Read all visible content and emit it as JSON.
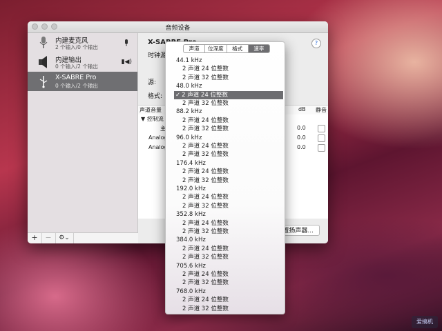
{
  "window": {
    "title": "音频设备"
  },
  "devices": [
    {
      "name": "内建麦克风",
      "sub": "2 个输入/0 个输出"
    },
    {
      "name": "内建输出",
      "sub": "0 个输入/2 个输出"
    },
    {
      "name": "X-SABRE Pro",
      "sub": "0 个输入/2 个输出"
    }
  ],
  "bottombar": {
    "add": "+",
    "remove": "−",
    "gear": "⚙︎⌄"
  },
  "main": {
    "device_title": "X-SABRE Pro",
    "clock_label": "时钟源",
    "source_label": "源:",
    "format_label": "格式:",
    "table_headers": {
      "channel_volume": "声道音量",
      "db": "dB",
      "mute": "静音"
    },
    "group_label": "▼ 控制流",
    "rows": [
      {
        "label": "主",
        "db": "0.0"
      },
      {
        "label": "Analog",
        "db": "0.0"
      },
      {
        "label": "Analog",
        "db": "0.0"
      }
    ],
    "config_speakers": "置扬声器..."
  },
  "popup": {
    "tabs": [
      "声道",
      "位深度",
      "格式",
      "速率"
    ],
    "active_tab": 3,
    "check": "✓",
    "groups": [
      {
        "rate": "44.1 kHz",
        "formats": [
          "2 声道 24 位整数",
          "2 声道 32 位整数"
        ],
        "selected": -1
      },
      {
        "rate": "48.0 kHz",
        "formats": [
          "2 声道 24 位整数",
          "2 声道 32 位整数"
        ],
        "selected": 0
      },
      {
        "rate": "88.2 kHz",
        "formats": [
          "2 声道 24 位整数",
          "2 声道 32 位整数"
        ],
        "selected": -1
      },
      {
        "rate": "96.0 kHz",
        "formats": [
          "2 声道 24 位整数",
          "2 声道 32 位整数"
        ],
        "selected": -1
      },
      {
        "rate": "176.4 kHz",
        "formats": [
          "2 声道 24 位整数",
          "2 声道 32 位整数"
        ],
        "selected": -1
      },
      {
        "rate": "192.0 kHz",
        "formats": [
          "2 声道 24 位整数",
          "2 声道 32 位整数"
        ],
        "selected": -1
      },
      {
        "rate": "352.8 kHz",
        "formats": [
          "2 声道 24 位整数",
          "2 声道 32 位整数"
        ],
        "selected": -1
      },
      {
        "rate": "384.0 kHz",
        "formats": [
          "2 声道 24 位整数",
          "2 声道 32 位整数"
        ],
        "selected": -1
      },
      {
        "rate": "705.6 kHz",
        "formats": [
          "2 声道 24 位整数",
          "2 声道 32 位整数"
        ],
        "selected": -1
      },
      {
        "rate": "768.0 kHz",
        "formats": [
          "2 声道 24 位整数",
          "2 声道 32 位整数"
        ],
        "selected": -1
      }
    ]
  },
  "watermark": {
    "text": "爱搞机"
  }
}
